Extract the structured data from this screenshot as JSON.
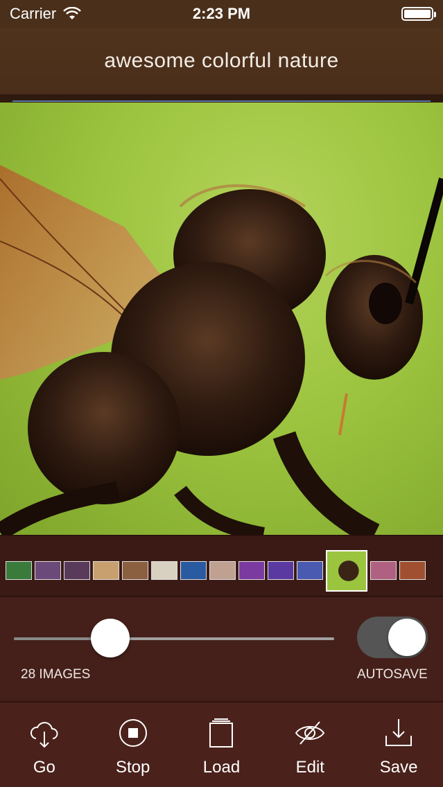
{
  "status_bar": {
    "carrier": "Carrier",
    "time": "2:23 PM",
    "wifi_icon": "wifi-icon",
    "battery_icon": "battery-icon"
  },
  "nav": {
    "title": "awesome colorful nature"
  },
  "main_image": {
    "subject_icon": "insect-macro-photo"
  },
  "thumbnails": {
    "items": [
      {
        "color": "#3a7a3a"
      },
      {
        "color": "#6b4a7a"
      },
      {
        "color": "#5a3a5a"
      },
      {
        "color": "#c8a070"
      },
      {
        "color": "#8a6040"
      },
      {
        "color": "#d8d0c0"
      },
      {
        "color": "#2a5aa0"
      },
      {
        "color": "#c0a090"
      },
      {
        "color": "#7a3aa0"
      },
      {
        "color": "#5a3aa0"
      },
      {
        "color": "#4a5ab0"
      },
      {
        "color": "#6a6a4a"
      },
      {
        "color": "#b06080"
      },
      {
        "color": "#a05030"
      }
    ],
    "selected_index": 11
  },
  "controls": {
    "slider_fraction": 0.3,
    "images_label": "28 IMAGES",
    "autosave_label": "AUTOSAVE",
    "autosave_on": true,
    "toggle_off_color": "#555555"
  },
  "toolbar": {
    "go_label": "Go",
    "stop_label": "Stop",
    "load_label": "Load",
    "edit_label": "Edit",
    "save_label": "Save"
  }
}
